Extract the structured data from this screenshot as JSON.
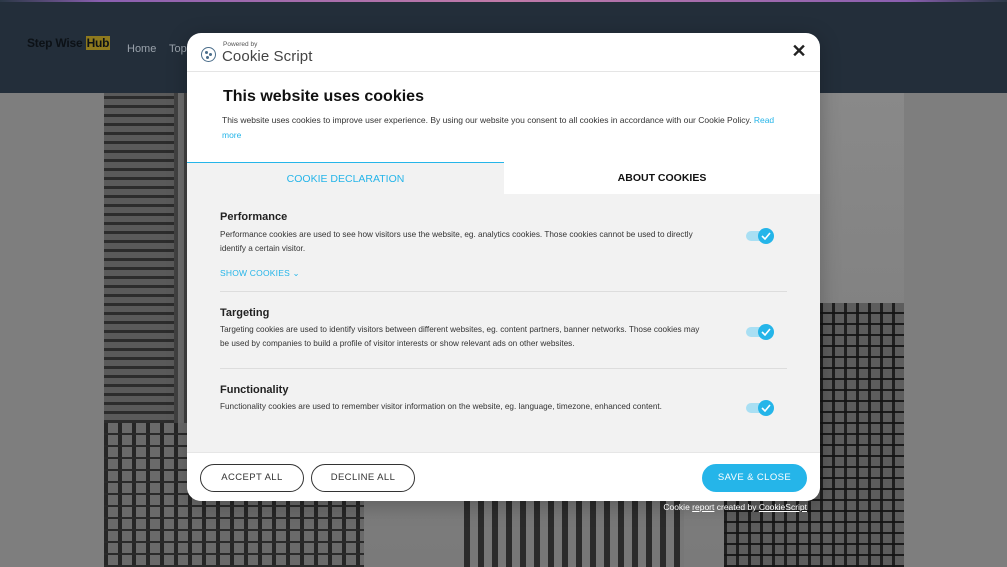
{
  "site": {
    "logo_text": "Step Wise ",
    "logo_accent": "Hub",
    "nav": [
      "Home",
      "Top"
    ]
  },
  "modal": {
    "powered_by": "Powered by",
    "brand": "Cookie Script",
    "close_symbol": "✕",
    "title": "This website uses cookies",
    "intro": "This website uses cookies to improve user experience. By using our website you consent to all cookies in accordance with our Cookie Policy. ",
    "read_more": "Read more",
    "tabs": [
      {
        "label": "COOKIE DECLARATION",
        "active": true
      },
      {
        "label": "ABOUT COOKIES",
        "active": false
      }
    ],
    "categories": [
      {
        "title": "Performance",
        "description": "Performance cookies are used to see how visitors use the website, eg. analytics cookies. Those cookies cannot be used to directly identify a certain visitor.",
        "enabled": true,
        "show_cookies": "SHOW COOKIES"
      },
      {
        "title": "Targeting",
        "description": "Targeting cookies are used to identify visitors between different websites, eg. content partners, banner networks. Those cookies may be used by companies to build a profile of visitor interests or show relevant ads on other websites.",
        "enabled": true
      },
      {
        "title": "Functionality",
        "description": "Functionality cookies are used to remember visitor information on the website, eg. language, timezone, enhanced content.",
        "enabled": true
      }
    ],
    "buttons": {
      "accept_all": "ACCEPT ALL",
      "decline_all": "DECLINE ALL",
      "save_close": "SAVE & CLOSE"
    }
  },
  "credit": {
    "prefix": "Cookie ",
    "report_link": "report",
    "middle": " created by ",
    "cookiescript_link": "CookieScript"
  },
  "colors": {
    "accent": "#25b5e9",
    "header_bg": "#232e3a"
  }
}
